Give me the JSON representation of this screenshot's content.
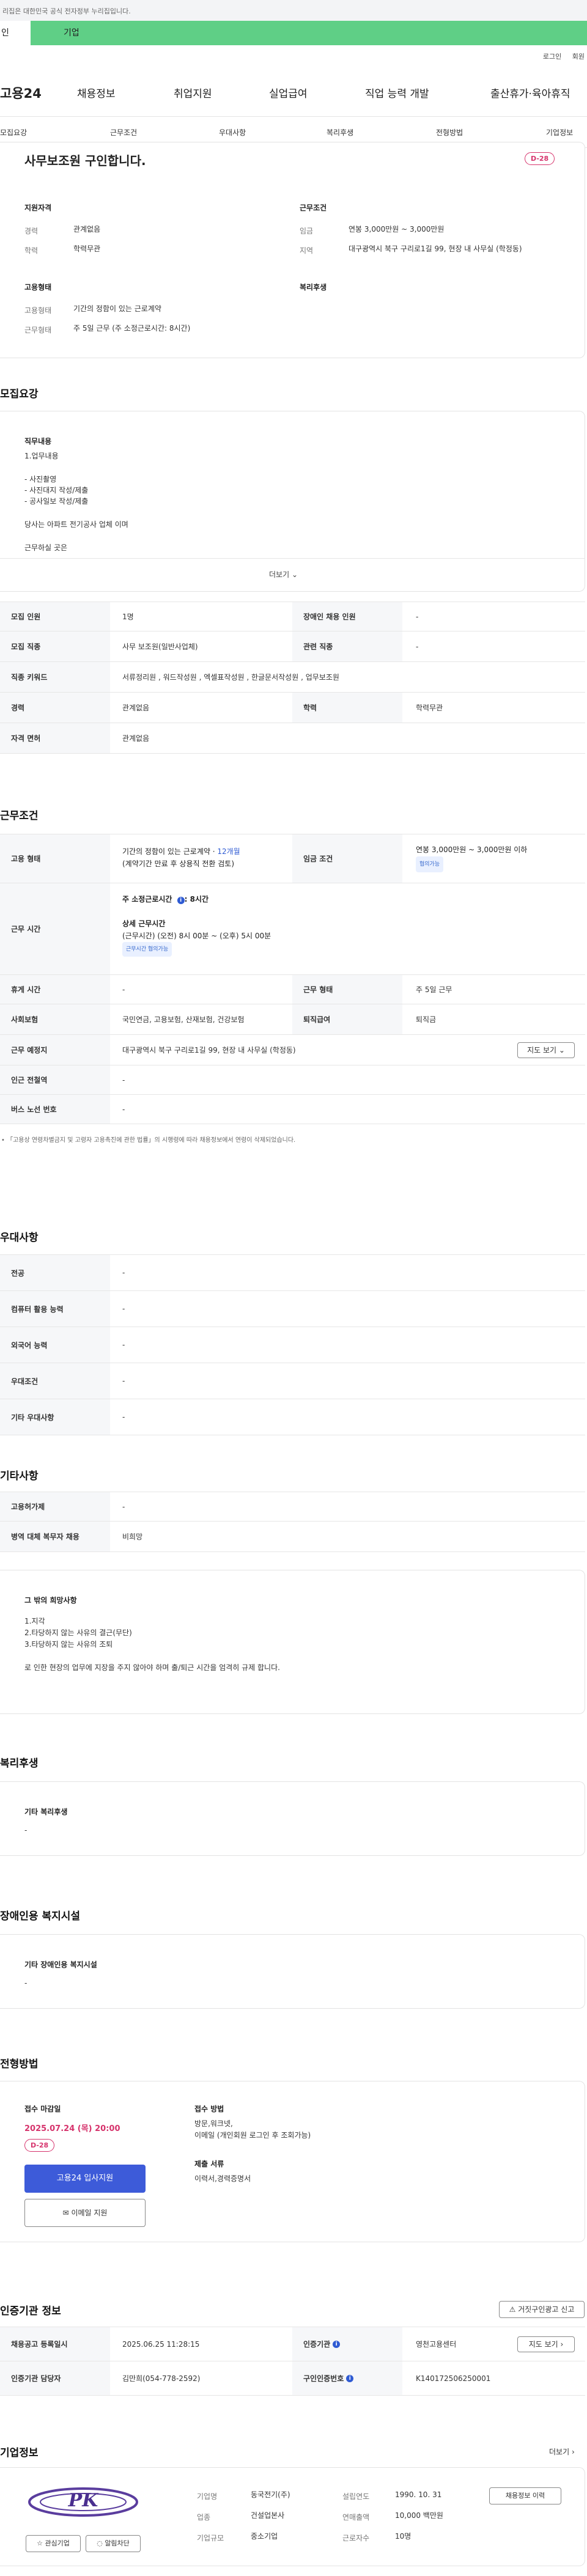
{
  "gov_banner": "리집은 대한민국 공식 전자정부 누리집입니다.",
  "user_tabs": [
    "인",
    "기업"
  ],
  "top_links": [
    "로그인",
    "회원"
  ],
  "gnb": {
    "logo": "고용24",
    "items": [
      "채용정보",
      "취업지원",
      "실업급여",
      "직업 능력 개발",
      "출산휴가·육아휴직"
    ]
  },
  "subnav": [
    "모집요강",
    "근무조건",
    "우대사항",
    "복리후생",
    "전형방법",
    "기업정보"
  ],
  "summary": {
    "title": "사무보조원 구인합니다.",
    "dday": "D-28",
    "qual_title": "지원자격",
    "career_label": "경력",
    "career_value": "관계없음",
    "edu_label": "학력",
    "edu_value": "학력무관",
    "emp_title": "고용형태",
    "emptype_label": "고용형태",
    "emptype_value": "기간의 정함이 있는 근로계약",
    "worktype_label": "근무형태",
    "worktype_value": "주 5일 근무 (주 소정근로시간: 8시간)",
    "cond_title": "근무조건",
    "wage_label": "임금",
    "wage_value": "연봉 3,000만원 ~ 3,000만원",
    "area_label": "지역",
    "area_value": "대구광역시 북구 구리로1길 99, 현장 내 사무실 (학정동)",
    "welfare_title": "복리후생"
  },
  "recruit": {
    "title": "모집요강",
    "duty_title": "직무내용",
    "duty_lines": [
      "1.업무내용",
      "",
      "- 사진촬영",
      "- 사진대지 작성/제출",
      "- 공사일보 작성/제출",
      "",
      "당사는 아파트 전기공사 업체 이며",
      "",
      "근무하실 곳은"
    ],
    "more": "더보기",
    "rows": [
      {
        "l1": "모집 인원",
        "v1": "1명",
        "l2": "장애인 채용 인원",
        "v2": "-"
      },
      {
        "l1": "모집 직종",
        "v1": "사무 보조원(일반사업체)",
        "l2": "관련 직종",
        "v2": "-"
      },
      {
        "l1": "직종 키워드",
        "v1": "서류정리원 , 워드작성원 , 엑셀표작성원 , 한글문서작성원 , 업무보조원",
        "l2": "",
        "v2": ""
      },
      {
        "l1": "경력",
        "v1": "관계없음",
        "l2": "학력",
        "v2": "학력무관"
      },
      {
        "l1": "자격 면허",
        "v1": "관계없음",
        "l2": "",
        "v2": ""
      }
    ]
  },
  "work": {
    "title": "근무조건",
    "emp_label": "고용 형태",
    "emp_v1": "기간의 정함이 있는 근로계약 · ",
    "emp_v1b": "12개월",
    "emp_v2": "(계약기간 만료 후 상용직 전환 검토)",
    "wage_label": "임금 조건",
    "wage_v": "연봉 3,000만원 ~ 3,000만원 이하",
    "wage_chip": "협의가능",
    "time_label": "근무 시간",
    "time_v1": "주 소정근로시간 ",
    "time_v1b": ": 8시간",
    "time_v2": "상세 근무시간",
    "time_v3": "(근무시간) (오전) 8시 00분 ~ (오후) 5시 00분",
    "time_chip": "근무시간 협의가능",
    "rows": [
      {
        "l1": "휴게 시간",
        "v1": "-",
        "l2": "근무 형태",
        "v2": "주 5일 근무"
      },
      {
        "l1": "사회보험",
        "v1": "국민연금, 고용보험, 산재보험, 건강보험",
        "l2": "퇴직급여",
        "v2": "퇴직금"
      }
    ],
    "place_label": "근무 예정지",
    "place_v": "대구광역시 북구 구리로1길 99, 현장 내 사무실 (학정동)",
    "map_btn": "지도 보기",
    "station_label": "인근 전철역",
    "station_v": "-",
    "bus_label": "버스 노선 번호",
    "bus_v": "-",
    "note": "「고용상 연령차별금지 및 고령자 고용촉진에 관한 법률」의 시행령에 따라 채용정보에서 연령이 삭제되었습니다."
  },
  "pref": {
    "title": "우대사항",
    "rows": [
      {
        "l": "전공",
        "v": "-"
      },
      {
        "l": "컴퓨터 활용 능력",
        "v": "-"
      },
      {
        "l": "외국어 능력",
        "v": "-"
      },
      {
        "l": "우대조건",
        "v": "-"
      },
      {
        "l": "기타 우대사항",
        "v": "-"
      }
    ]
  },
  "etc": {
    "title": "기타사항",
    "rows": [
      {
        "l": "고용허가제",
        "v": "-"
      },
      {
        "l": "병역 대체 복무자 채용",
        "v": "비희망"
      }
    ],
    "hope_title": "그 밖의 희망사항",
    "hope_lines": [
      "1.지각",
      "2.타당하지 않는 사유의 결근(무단)",
      "3.타당하지 않는 사유의 조퇴",
      "",
      "로 인한 현장의 업무에 지장을 주지 않아야 하며 출/퇴근 시간을 엄격히 규제 합니다."
    ]
  },
  "welfare": {
    "title": "복리후생",
    "item_title": "기타 복리후생",
    "item_v": "-"
  },
  "disabled": {
    "title": "장애인용 복지시설",
    "item_title": "기타 장애인용 복지시설",
    "item_v": "-"
  },
  "apply": {
    "title": "전형방법",
    "deadline_title": "접수 마감일",
    "deadline": "2025.07.24 (목) 20:00",
    "dday": "D-28",
    "apply_btn": "고용24 입사지원",
    "email_btn": "이메일 지원",
    "method_title": "접수 방법",
    "method_lines": [
      "방문,워크넷,",
      "이메일 (개인회원 로그인 후 조회가능)"
    ],
    "doc_title": "제출 서류",
    "doc_v": "이력서,경력증명서"
  },
  "cert": {
    "title": "인증기관 정보",
    "report_btn": "거짓구인광고 신고",
    "r1": {
      "l1": "채용공고 등록일시",
      "v1": "2025.06.25 11:28:15",
      "l2": "인증기관",
      "v2": "영천고용센터",
      "btn": "지도 보기"
    },
    "r2": {
      "l1": "인증기관 담당자",
      "v1": "김만희(054-778-2592)",
      "l2": "구인인증번호",
      "v2": "K140172506250001"
    }
  },
  "company": {
    "title": "기업정보",
    "more": "더보기",
    "logo_text": "PK",
    "fav_btn": "관심기업",
    "follow_btn": "알림차단",
    "name_l": "기업명",
    "name_v": "동국전기(주)",
    "ind_l": "업종",
    "ind_v": "건설업본사",
    "size_l": "기업규모",
    "size_v": "중소기업",
    "year_l": "설립연도",
    "year_v": "1990. 10. 31",
    "sales_l": "연매출액",
    "sales_v": "10,000 백만원",
    "emp_l": "근로자수",
    "emp_v": "10명",
    "jobs_btn": "채용정보 이력"
  },
  "colors": {
    "accent": "#2f5bd3",
    "green": "#5fcf86",
    "red": "#d6336c"
  }
}
